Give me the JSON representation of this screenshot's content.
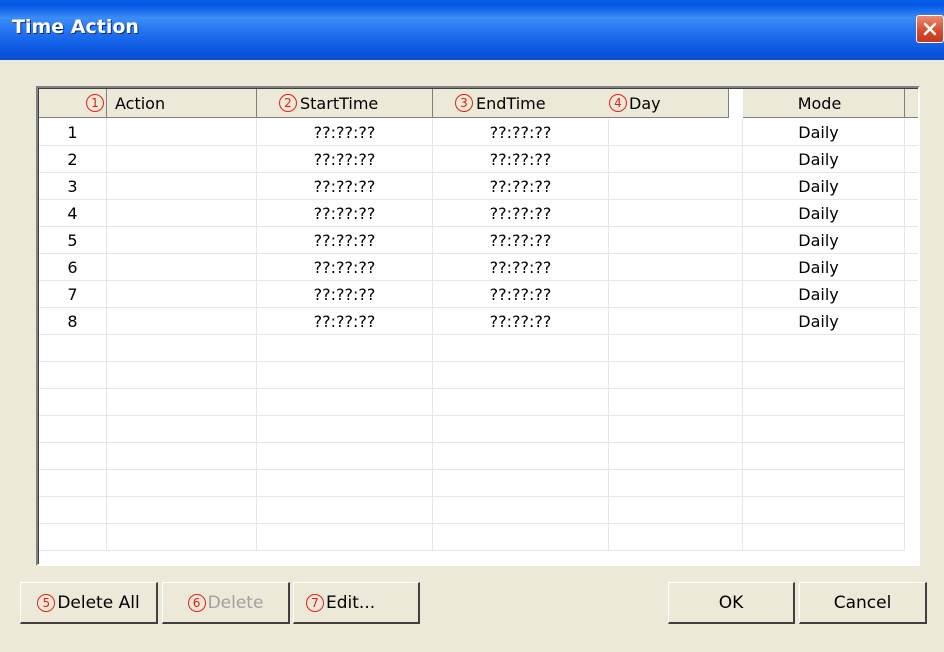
{
  "window": {
    "title": "Time Action"
  },
  "columns": [
    {
      "marker": "1",
      "label": "Action"
    },
    {
      "marker": "2",
      "label": "StartTime"
    },
    {
      "marker": "3",
      "label": "EndTime"
    },
    {
      "marker": "4",
      "label": "Day"
    },
    {
      "marker": "",
      "label": "Mode"
    }
  ],
  "rows": [
    {
      "num": "1",
      "action": "",
      "start": "??:??:??",
      "end": "??:??:??",
      "day": "",
      "mode": "Daily",
      "selected": true
    },
    {
      "num": "2",
      "action": "",
      "start": "??:??:??",
      "end": "??:??:??",
      "day": "",
      "mode": "Daily"
    },
    {
      "num": "3",
      "action": "",
      "start": "??:??:??",
      "end": "??:??:??",
      "day": "",
      "mode": "Daily"
    },
    {
      "num": "4",
      "action": "",
      "start": "??:??:??",
      "end": "??:??:??",
      "day": "",
      "mode": "Daily"
    },
    {
      "num": "5",
      "action": "",
      "start": "??:??:??",
      "end": "??:??:??",
      "day": "",
      "mode": "Daily"
    },
    {
      "num": "6",
      "action": "",
      "start": "??:??:??",
      "end": "??:??:??",
      "day": "",
      "mode": "Daily"
    },
    {
      "num": "7",
      "action": "",
      "start": "??:??:??",
      "end": "??:??:??",
      "day": "",
      "mode": "Daily"
    },
    {
      "num": "8",
      "action": "",
      "start": "??:??:??",
      "end": "??:??:??",
      "day": "",
      "mode": "Daily"
    }
  ],
  "buttons": {
    "delete_all": {
      "marker": "5",
      "label": "Delete All"
    },
    "delete": {
      "marker": "6",
      "label": "Delete"
    },
    "edit": {
      "marker": "7",
      "label": "Edit..."
    },
    "ok": {
      "label": "OK"
    },
    "cancel": {
      "label": "Cancel"
    }
  },
  "colors": {
    "selection": "#316ac5",
    "marker": "#e3201b",
    "title_bar": "#0a56e0"
  },
  "icons": {
    "close": "close-icon"
  }
}
